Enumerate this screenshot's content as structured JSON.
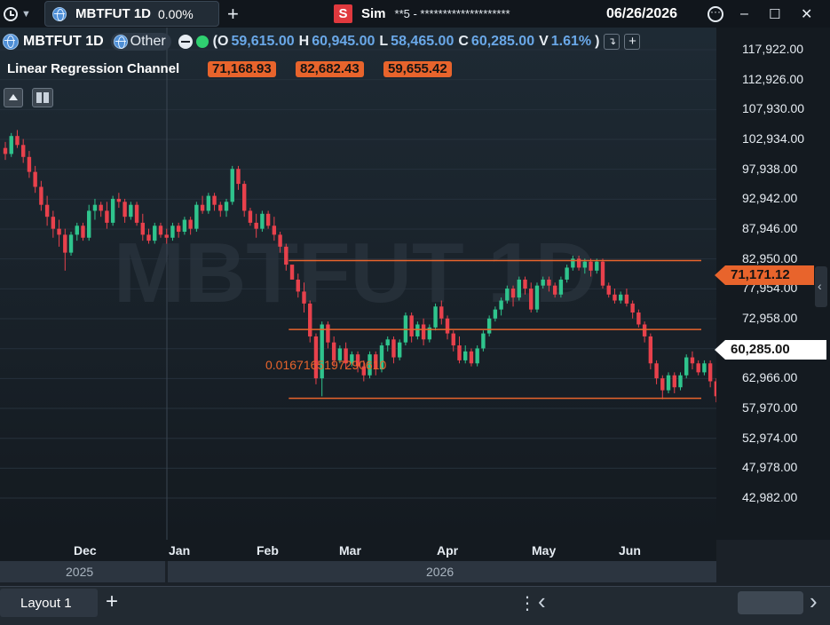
{
  "topbar": {
    "tab_symbol": "MBTFUT 1D",
    "tab_change": "0.00%",
    "add_tab": "+",
    "account_badge": "S",
    "account_name": "Sim",
    "account_number": "**5 - ********************",
    "date": "06/26/2026",
    "window_min": "–",
    "window_max": "☐",
    "window_close": "✕"
  },
  "legend": {
    "symbol": "MBTFUT 1D",
    "exchange": "Other",
    "ohlc_open_label": "O",
    "ohlc_open": "59,615.00",
    "ohlc_high_label": "H",
    "ohlc_high": "60,945.00",
    "ohlc_low_label": "L",
    "ohlc_low": "58,465.00",
    "ohlc_close_label": "C",
    "ohlc_close": "60,285.00",
    "ohlc_volume_label": "V",
    "ohlc_change": "1.61%",
    "paren_open": "(",
    "paren_close": ")"
  },
  "indicator": {
    "name": "Linear Regression Channel",
    "values": [
      "71,168.93",
      "82,682.43",
      "59,655.42"
    ],
    "slope_label": "0.0167165197290610"
  },
  "watermark": "MBTFUT 1D",
  "y_axis": {
    "ticks": [
      "117,922.00",
      "112,926.00",
      "107,930.00",
      "102,934.00",
      "97,938.00",
      "92,942.00",
      "87,946.00",
      "82,950.00",
      "77,954.00",
      "72,958.00",
      "67,962.00",
      "62,966.00",
      "57,970.00",
      "52,974.00",
      "47,978.00",
      "42,982.00"
    ],
    "channel_mid_label": "71,171.12",
    "last_price_label": "60,285.00"
  },
  "x_axis": {
    "months": [
      "Dec",
      "Jan",
      "Feb",
      "Mar",
      "Apr",
      "May",
      "Jun"
    ],
    "years": [
      "2025",
      "2026"
    ]
  },
  "bottom": {
    "layout_tab": "Layout 1",
    "add_layout": "+",
    "more": "⋮",
    "scroll_left": "‹",
    "scroll_right": "›"
  },
  "colors": {
    "up": "#2fc48d",
    "down": "#e8414c",
    "channel": "#e8642c",
    "background": "#1b2128"
  },
  "chart_data": {
    "type": "candlestick",
    "ylim": [
      38000,
      121000
    ],
    "regression_channel": {
      "start_index": 47,
      "mid_end": 71168.93,
      "upper_end": 82682.43,
      "lower_end": 59655.42,
      "slope": 0.016716519729061
    },
    "candles": [
      [
        101500,
        102500,
        99500,
        100500
      ],
      [
        100500,
        104000,
        100000,
        103500
      ],
      [
        103500,
        104500,
        101500,
        102000
      ],
      [
        102000,
        103000,
        99000,
        100000
      ],
      [
        100000,
        101000,
        96500,
        97500
      ],
      [
        97500,
        98500,
        94000,
        95000
      ],
      [
        95000,
        96000,
        91000,
        92000
      ],
      [
        92000,
        93500,
        88500,
        90000
      ],
      [
        90000,
        91000,
        86500,
        88000
      ],
      [
        88000,
        89500,
        85000,
        87000
      ],
      [
        87000,
        88000,
        81000,
        84000
      ],
      [
        84000,
        87500,
        83500,
        87000
      ],
      [
        87000,
        89000,
        86000,
        88500
      ],
      [
        88500,
        89000,
        86000,
        86500
      ],
      [
        86500,
        92000,
        86000,
        91000
      ],
      [
        91000,
        93000,
        89500,
        92000
      ],
      [
        92000,
        92500,
        90000,
        91000
      ],
      [
        91000,
        92500,
        88000,
        89000
      ],
      [
        89000,
        93500,
        88500,
        93000
      ],
      [
        93000,
        94000,
        91500,
        92500
      ],
      [
        92500,
        93000,
        89000,
        90000
      ],
      [
        90000,
        92500,
        89500,
        92000
      ],
      [
        92000,
        92500,
        88500,
        89000
      ],
      [
        89000,
        90500,
        86000,
        87000
      ],
      [
        87000,
        88000,
        85500,
        86000
      ],
      [
        86000,
        89000,
        85500,
        88500
      ],
      [
        88500,
        89000,
        86500,
        87000
      ],
      [
        87000,
        88000,
        85500,
        86500
      ],
      [
        86500,
        89000,
        86000,
        88500
      ],
      [
        88500,
        89000,
        86500,
        87500
      ],
      [
        87500,
        90000,
        87000,
        89500
      ],
      [
        89500,
        90000,
        87000,
        88000
      ],
      [
        88000,
        92500,
        87500,
        92000
      ],
      [
        92000,
        93500,
        90500,
        91000
      ],
      [
        91000,
        94000,
        90500,
        93500
      ],
      [
        93500,
        94000,
        91000,
        92000
      ],
      [
        92000,
        92500,
        90000,
        91000
      ],
      [
        91000,
        93000,
        90000,
        92500
      ],
      [
        92500,
        98500,
        92000,
        98000
      ],
      [
        98000,
        98500,
        94500,
        95500
      ],
      [
        95500,
        96000,
        90000,
        91000
      ],
      [
        91000,
        91500,
        88500,
        89000
      ],
      [
        89000,
        90500,
        86500,
        88000
      ],
      [
        88000,
        91000,
        87500,
        90500
      ],
      [
        90500,
        91000,
        88000,
        88500
      ],
      [
        88500,
        90000,
        86000,
        87000
      ],
      [
        87000,
        87500,
        84000,
        85000
      ],
      [
        85000,
        85500,
        81000,
        82000
      ],
      [
        82000,
        81500,
        80000,
        79500
      ],
      [
        79500,
        80500,
        76500,
        77500
      ],
      [
        77500,
        79000,
        74000,
        75500
      ],
      [
        75500,
        76000,
        69000,
        70000
      ],
      [
        70000,
        70500,
        62000,
        63000
      ],
      [
        63000,
        72500,
        60000,
        72000
      ],
      [
        72000,
        72500,
        68000,
        69000
      ],
      [
        69000,
        70000,
        65000,
        66000
      ],
      [
        66000,
        68500,
        65500,
        68000
      ],
      [
        68000,
        69000,
        64500,
        65500
      ],
      [
        65500,
        67500,
        65000,
        67000
      ],
      [
        67000,
        67500,
        64000,
        65000
      ],
      [
        65000,
        66000,
        62500,
        63500
      ],
      [
        63500,
        67500,
        63000,
        67000
      ],
      [
        67000,
        67500,
        63500,
        64500
      ],
      [
        64500,
        69000,
        64000,
        68500
      ],
      [
        68500,
        70000,
        67500,
        69500
      ],
      [
        69500,
        70000,
        65500,
        66500
      ],
      [
        66500,
        69500,
        66000,
        69000
      ],
      [
        69000,
        74000,
        68500,
        73500
      ],
      [
        73500,
        74000,
        69000,
        70000
      ],
      [
        70000,
        72500,
        69500,
        72000
      ],
      [
        72000,
        73000,
        68500,
        69500
      ],
      [
        69500,
        72000,
        69000,
        71500
      ],
      [
        71500,
        75500,
        71000,
        75000
      ],
      [
        75000,
        76000,
        72000,
        73000
      ],
      [
        73000,
        73500,
        69500,
        70500
      ],
      [
        70500,
        71000,
        67500,
        68500
      ],
      [
        68500,
        70000,
        65500,
        66000
      ],
      [
        66000,
        68500,
        65500,
        67500
      ],
      [
        67500,
        68000,
        65000,
        65500
      ],
      [
        65500,
        68500,
        65000,
        68000
      ],
      [
        68000,
        71000,
        67500,
        70500
      ],
      [
        70500,
        73500,
        70000,
        73000
      ],
      [
        73000,
        75000,
        72500,
        74500
      ],
      [
        74500,
        76500,
        73500,
        76000
      ],
      [
        76000,
        78500,
        75500,
        78000
      ],
      [
        78000,
        78500,
        75000,
        76500
      ],
      [
        76500,
        80000,
        76000,
        79500
      ],
      [
        79500,
        80000,
        77000,
        78000
      ],
      [
        78000,
        79000,
        74000,
        74500
      ],
      [
        74500,
        79000,
        74000,
        78500
      ],
      [
        78500,
        80000,
        78000,
        79500
      ],
      [
        79500,
        80000,
        77500,
        78500
      ],
      [
        78500,
        79000,
        76500,
        77000
      ],
      [
        77000,
        80000,
        76500,
        79500
      ],
      [
        79500,
        82000,
        79000,
        81500
      ],
      [
        81500,
        83500,
        81000,
        83000
      ],
      [
        83000,
        83500,
        81000,
        81500
      ],
      [
        81500,
        83000,
        80500,
        82500
      ],
      [
        82500,
        83000,
        80000,
        81000
      ],
      [
        81000,
        83000,
        80500,
        82500
      ],
      [
        82500,
        83000,
        78000,
        78500
      ],
      [
        78500,
        79000,
        76500,
        77000
      ],
      [
        77000,
        78000,
        75500,
        76000
      ],
      [
        76000,
        77500,
        75500,
        77000
      ],
      [
        77000,
        78000,
        75000,
        75500
      ],
      [
        75500,
        76000,
        73000,
        74000
      ],
      [
        74000,
        74500,
        71500,
        72000
      ],
      [
        72000,
        72500,
        69000,
        70000
      ],
      [
        70000,
        70500,
        64500,
        65500
      ],
      [
        65500,
        66000,
        62000,
        63000
      ],
      [
        63000,
        63500,
        59500,
        61000
      ],
      [
        61000,
        64000,
        60500,
        63500
      ],
      [
        63500,
        64000,
        60500,
        61500
      ],
      [
        61500,
        64000,
        61000,
        63500
      ],
      [
        63500,
        67000,
        63000,
        66500
      ],
      [
        66500,
        67500,
        64500,
        65500
      ],
      [
        65500,
        66000,
        63500,
        64000
      ],
      [
        64000,
        66000,
        63500,
        65500
      ],
      [
        65500,
        66000,
        61500,
        62500
      ],
      [
        62500,
        63000,
        59000,
        60000
      ],
      [
        60000,
        60500,
        58000,
        59615
      ],
      [
        59615,
        60945,
        58465,
        60285
      ]
    ]
  }
}
